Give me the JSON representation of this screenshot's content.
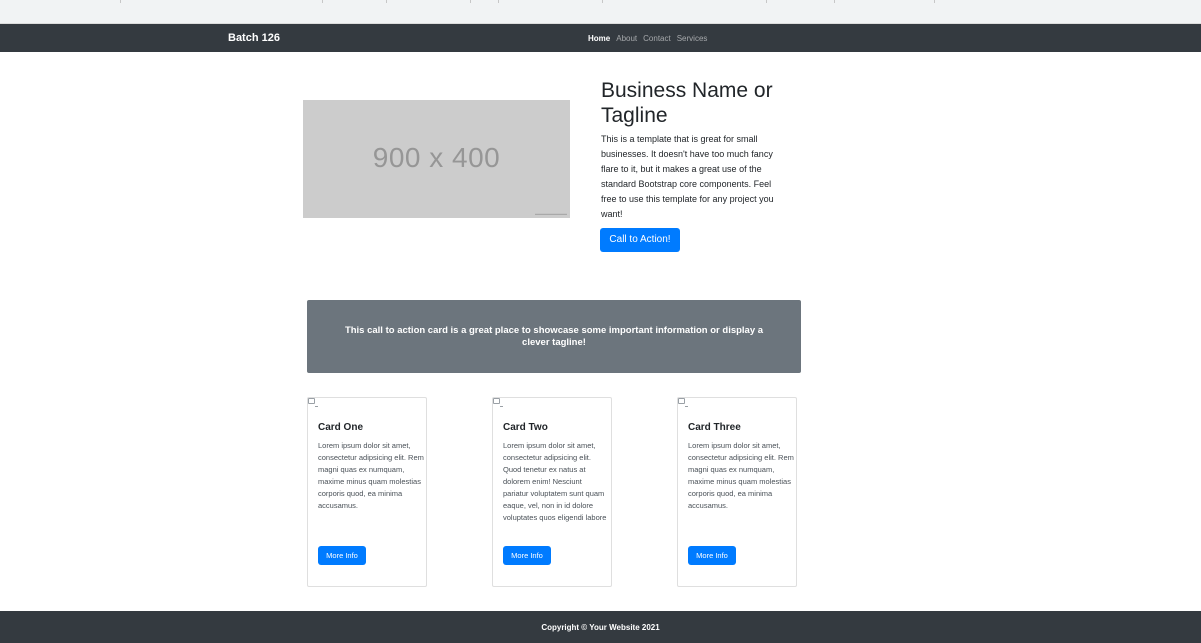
{
  "navbar": {
    "brand": "Batch 126",
    "links": [
      {
        "label": "Home",
        "active": true
      },
      {
        "label": "About",
        "active": false
      },
      {
        "label": "Contact",
        "active": false
      },
      {
        "label": "Services",
        "active": false
      }
    ]
  },
  "hero": {
    "image_text": "900 x 400",
    "title": "Business Name or Tagline",
    "description": "This is a template that is great for small businesses. It doesn't have too much fancy flare to it, but it makes a great use of the standard Bootstrap core components. Feel free to use this template for any project you want!",
    "button_label": "Call to Action!"
  },
  "cta_card": {
    "text": "This call to action card is a great place to showcase some important information or display a clever tagline!"
  },
  "cards": [
    {
      "title": "Card One",
      "text": "Lorem ipsum dolor sit amet, consectetur adipsicing elit. Rem magni quas ex numquam, maxime minus quam molestias corporis quod, ea minima accusamus.",
      "button_label": "More Info"
    },
    {
      "title": "Card Two",
      "text": "Lorem ipsum dolor sit amet, consectetur adipsicing elit. Quod tenetur ex natus at dolorem enim! Nesciunt pariatur voluptatem sunt quam eaque, vel, non in id dolore voluptates quos eligendi labore",
      "button_label": "More Info"
    },
    {
      "title": "Card Three",
      "text": "Lorem ipsum dolor sit amet, consectetur adipsicing elit. Rem magni quas ex numquam, maxime minus quam molestias corporis quod, ea minima accusamus.",
      "button_label": "More Info"
    }
  ],
  "footer": {
    "text": "Copyright © Your Website 2021"
  },
  "colors": {
    "navbar_bg": "#343a40",
    "primary": "#007bff",
    "cta_bg": "#6c757d",
    "placeholder_bg": "#cccccc"
  }
}
